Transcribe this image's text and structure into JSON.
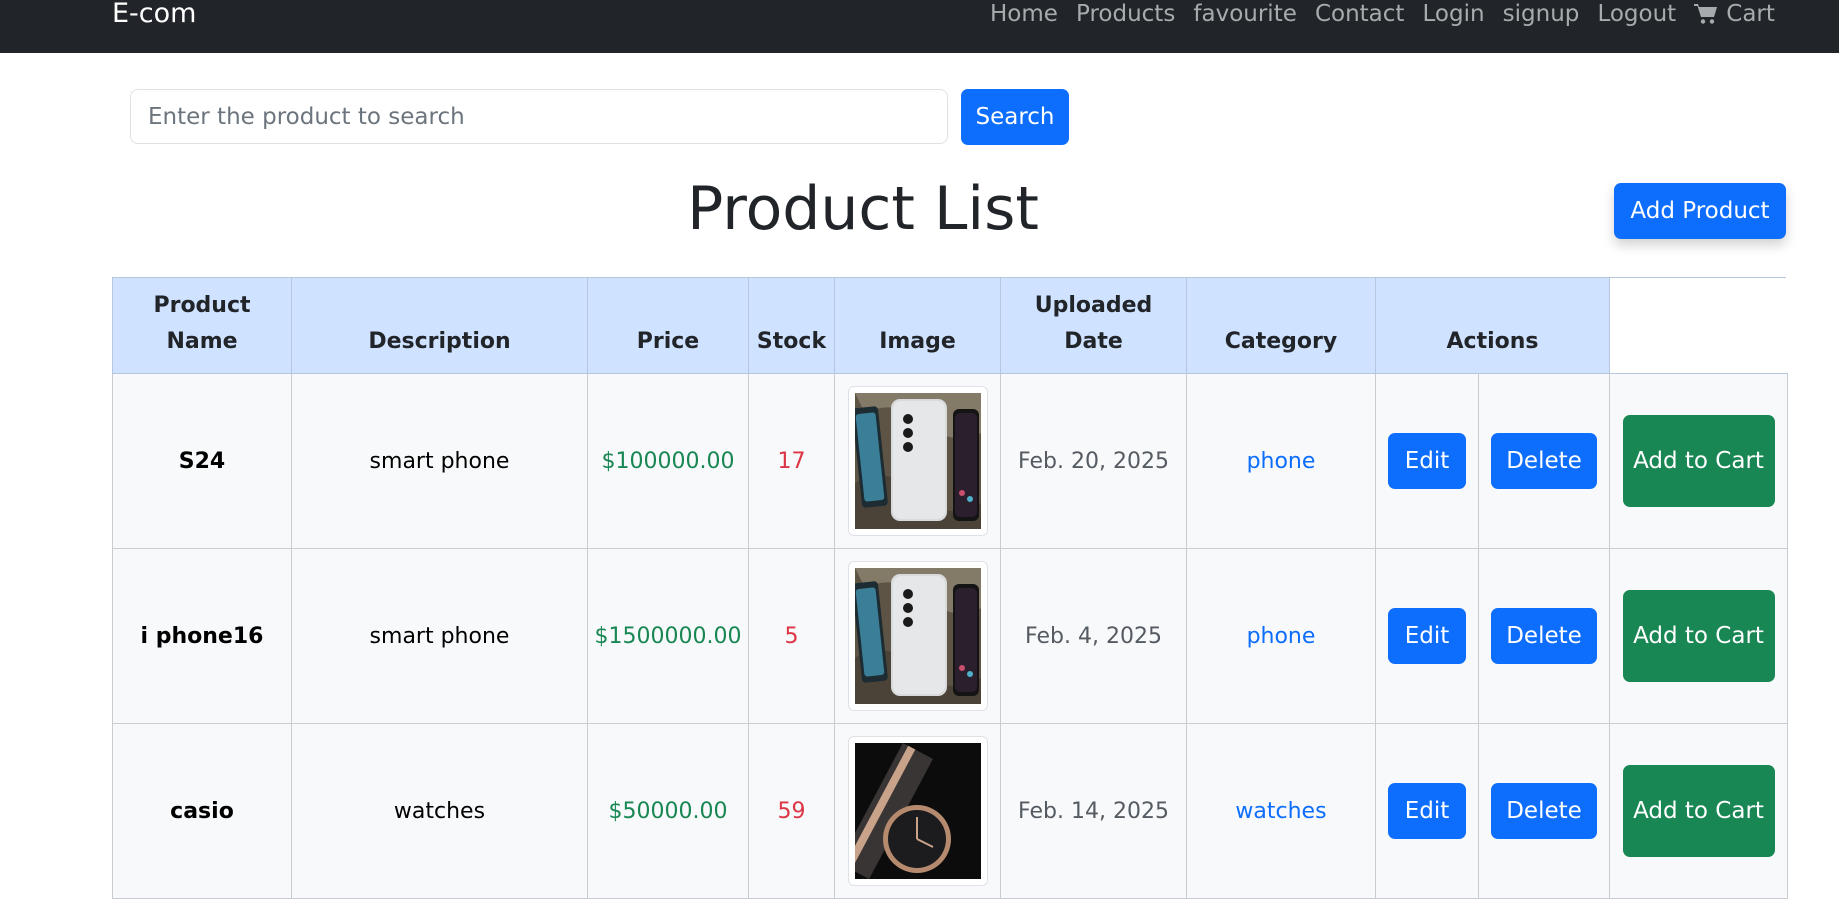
{
  "navbar": {
    "brand": "E-com",
    "links": [
      "Home",
      "Products",
      "favourite",
      "Contact",
      "Login",
      "signup",
      "Logout"
    ],
    "cart_label": "Cart",
    "cart_icon": "cart-icon"
  },
  "search": {
    "placeholder": "Enter the product to search",
    "value": "",
    "button_label": "Search"
  },
  "page": {
    "title": "Product List",
    "add_product_label": "Add Product"
  },
  "table": {
    "headers": {
      "name": "Product Name",
      "description": "Description",
      "price": "Price",
      "stock": "Stock",
      "image": "Image",
      "date": "Uploaded Date",
      "category": "Category",
      "actions": "Actions"
    },
    "rows": [
      {
        "name": "S24",
        "description": "smart phone",
        "price": "$100000.00",
        "stock": "17",
        "image": "phone-image",
        "date": "Feb. 20, 2025",
        "category": "phone",
        "edit": "Edit",
        "delete": "Delete",
        "add_to_cart": "Add to Cart"
      },
      {
        "name": "i phone16",
        "description": "smart phone",
        "price": "$1500000.00",
        "stock": "5",
        "image": "phone-image",
        "date": "Feb. 4, 2025",
        "category": "phone",
        "edit": "Edit",
        "delete": "Delete",
        "add_to_cart": "Add to Cart"
      },
      {
        "name": "casio",
        "description": "watches",
        "price": "$50000.00",
        "stock": "59",
        "image": "watch-image",
        "date": "Feb. 14, 2025",
        "category": "watches",
        "edit": "Edit",
        "delete": "Delete",
        "add_to_cart": "Add to Cart"
      }
    ]
  },
  "colors": {
    "navbar_bg": "#212529",
    "primary": "#0d6efd",
    "success": "#198754",
    "danger": "#dc3545",
    "header_bg": "#cfe2ff"
  }
}
